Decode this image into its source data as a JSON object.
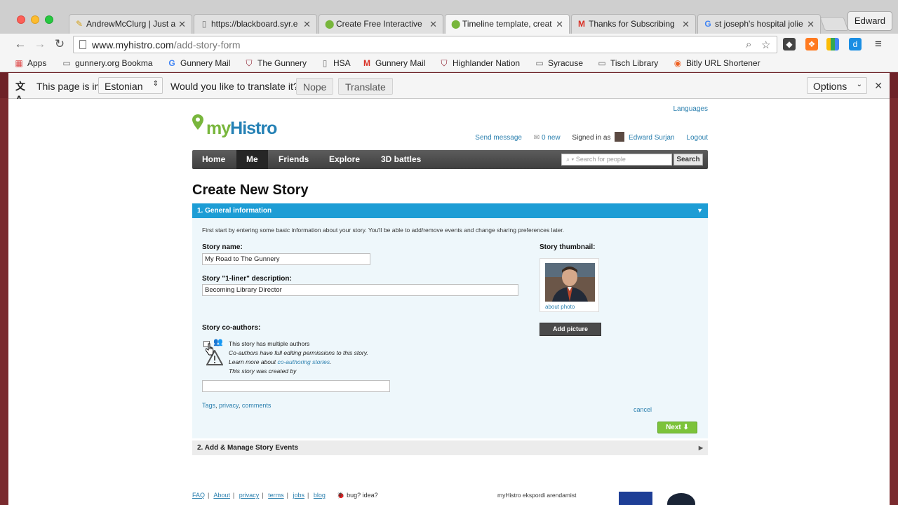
{
  "browser": {
    "tabs": [
      {
        "title": "AndrewMcClurg | Just a",
        "icon": "pencil-icon"
      },
      {
        "title": "https://blackboard.syr.e",
        "icon": "page-icon"
      },
      {
        "title": "Create Free Interactive",
        "icon": "pin-icon"
      },
      {
        "title": "Timeline template, creat",
        "icon": "pin-icon"
      },
      {
        "title": "Thanks for Subscribing",
        "icon": "gmail-icon"
      },
      {
        "title": "st joseph's hospital jolie",
        "icon": "google-icon"
      }
    ],
    "profile_name": "Edward",
    "url_host": "www.myhistro.com",
    "url_path": "/add-story-form",
    "bookmarks": [
      {
        "label": "Apps"
      },
      {
        "label": "gunnery.org Bookma"
      },
      {
        "label": "Gunnery Mail"
      },
      {
        "label": "The Gunnery"
      },
      {
        "label": "HSA"
      },
      {
        "label": "Gunnery Mail"
      },
      {
        "label": "Highlander Nation"
      },
      {
        "label": "Syracuse"
      },
      {
        "label": "Tisch Library"
      },
      {
        "label": "Bitly URL Shortener"
      }
    ]
  },
  "translate_bar": {
    "prefix": "This page is in",
    "language": "Estonian",
    "question": "Would you like to translate it?",
    "nope": "Nope",
    "translate": "Translate",
    "options": "Options"
  },
  "site": {
    "languages": "Languages",
    "logo_my": "my",
    "logo_histro": "Histro",
    "send_message": "Send message",
    "new_messages": "0 new",
    "signed_in_as": "Signed in as",
    "user_name": "Edward Surjan",
    "logout": "Logout",
    "nav": [
      "Home",
      "Me",
      "Friends",
      "Explore",
      "3D battles"
    ],
    "search_placeholder": "Search for people",
    "search_button": "Search"
  },
  "form": {
    "page_title": "Create New Story",
    "section1_title": "1. General information",
    "intro": "First start by entering some basic information about your story. You'll be able to add/remove events and change sharing preferences later.",
    "story_name_label": "Story name:",
    "story_name_value": "My Road to The Gunnery",
    "oneliner_label": "Story \"1-liner\" description:",
    "oneliner_value": "Becoming Library Director",
    "coauthors_label": "Story co-authors:",
    "coauthors_checkbox": "This story has multiple authors",
    "coauthors_note1": "Co-authors have full editing permissions to this story.",
    "coauthors_note2_prefix": "Learn more about",
    "coauthors_note2_link": "co-authoring stories",
    "coauthors_created_by": "This story was created by",
    "tags_link": "Tags",
    "privacy_link": "privacy",
    "comments_link": "comments",
    "thumbnail_label": "Story thumbnail:",
    "about_photo": "about photo",
    "add_picture": "Add picture",
    "cancel": "cancel",
    "next": "Next",
    "section2_title": "2. Add & Manage Story Events"
  },
  "footer": {
    "links": [
      "FAQ",
      "About",
      "privacy",
      "terms",
      "jobs",
      "blog"
    ],
    "bug": "bug? idea?",
    "estonia_text": "myHistro ekspordi arendamist"
  }
}
